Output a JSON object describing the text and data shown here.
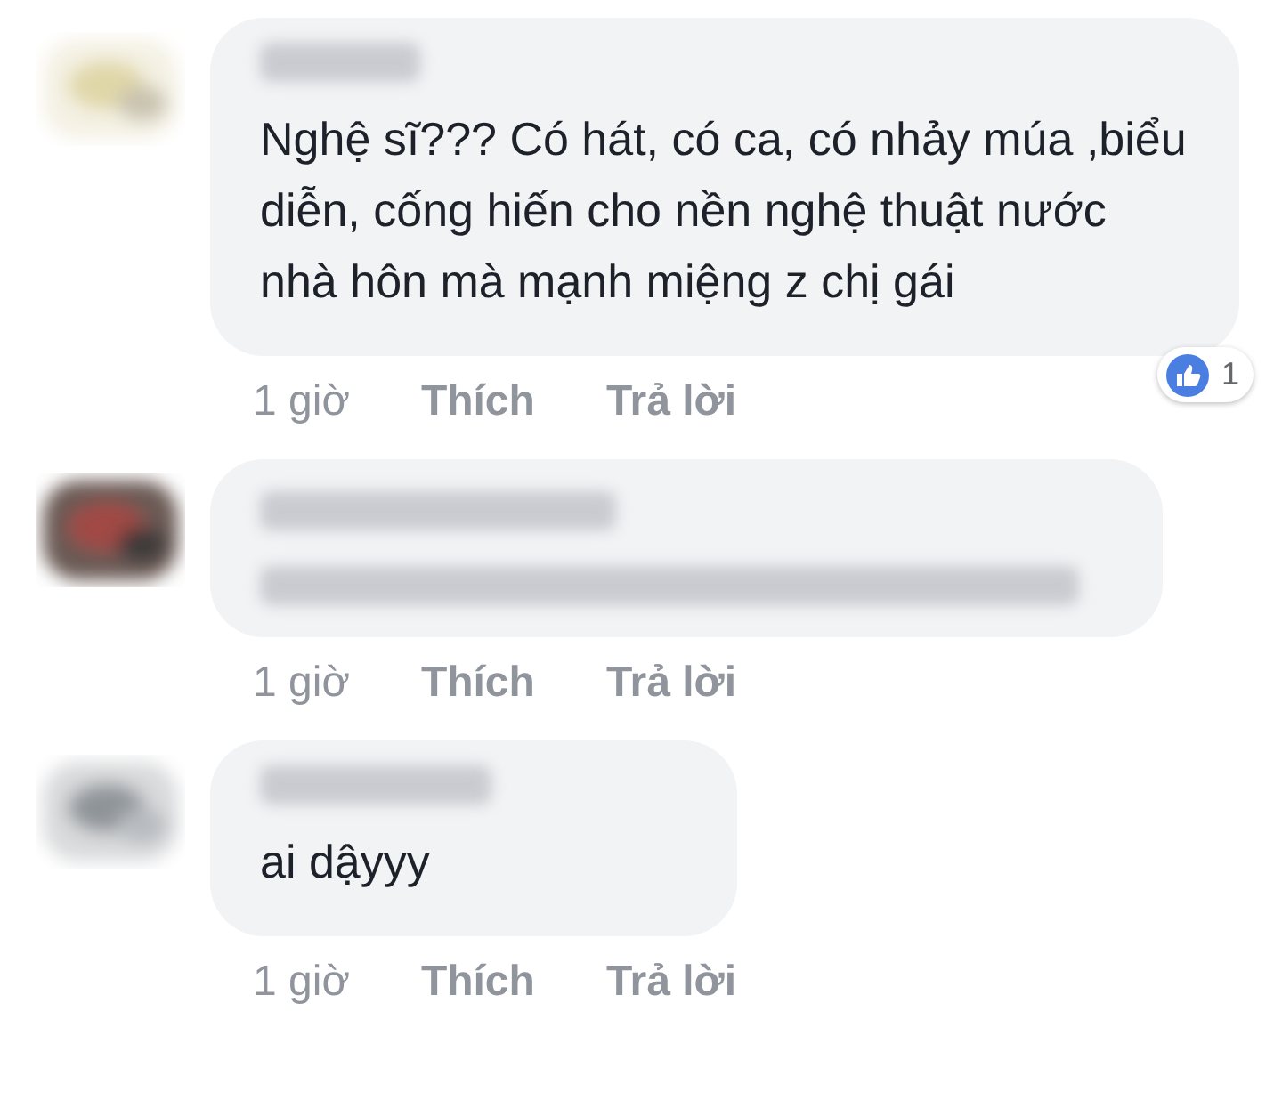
{
  "comments": [
    {
      "kind": "text",
      "text": "Nghệ sĩ??? Có hát, có ca, có nhảy múa ,biểu diễn, cống hiến cho nền nghệ thuật nước nhà hôn mà mạnh miệng z chị gái",
      "time": "1 giờ",
      "like": "Thích",
      "reply": "Trả lời",
      "reaction_count": "1"
    },
    {
      "kind": "blurred",
      "time": "1 giờ",
      "like": "Thích",
      "reply": "Trả lời"
    },
    {
      "kind": "text",
      "text": "ai dậyyy",
      "time": "1 giờ",
      "like": "Thích",
      "reply": "Trả lời"
    }
  ]
}
